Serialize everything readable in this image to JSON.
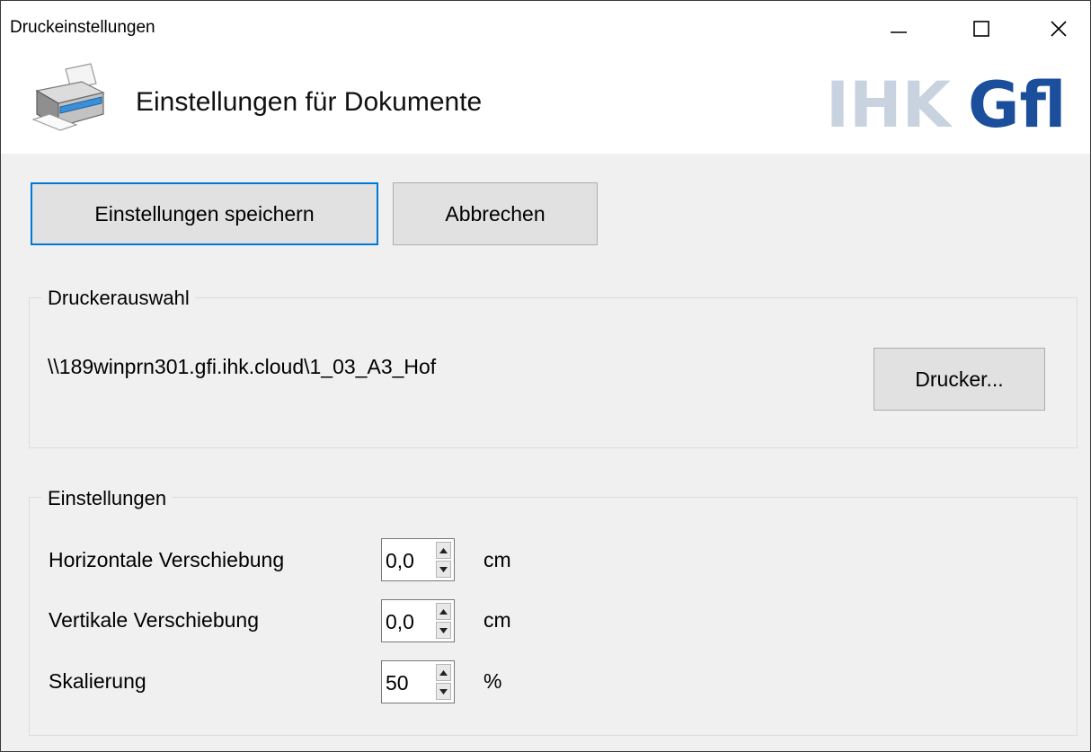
{
  "window": {
    "title": "Druckeinstellungen",
    "controls": {
      "minimize_icon": "minimize-icon",
      "maximize_icon": "maximize-icon",
      "close_icon": "close-icon"
    }
  },
  "header": {
    "title": "Einstellungen für Dokumente",
    "icon": "printer-icon",
    "logo_text": "IHKGfl"
  },
  "toolbar": {
    "save_label": "Einstellungen speichern",
    "cancel_label": "Abbrechen"
  },
  "printer_group": {
    "label": "Druckerauswahl",
    "printer_path": "\\\\189winprn301.gfi.ihk.cloud\\1_03_A3_Hof",
    "printer_button_label": "Drucker..."
  },
  "settings_group": {
    "label": "Einstellungen",
    "fields": [
      {
        "label": "Horizontale Verschiebung",
        "value": "0,0",
        "unit": "cm"
      },
      {
        "label": "Vertikale Verschiebung",
        "value": "0,0",
        "unit": "cm"
      },
      {
        "label": "Skalierung",
        "value": "50",
        "unit": "%"
      }
    ]
  },
  "colors": {
    "accent": "#0078d7",
    "logo_light": "#c9d3e0",
    "logo_dark": "#1b4e9b",
    "window_bg": "#f0f0f0"
  }
}
